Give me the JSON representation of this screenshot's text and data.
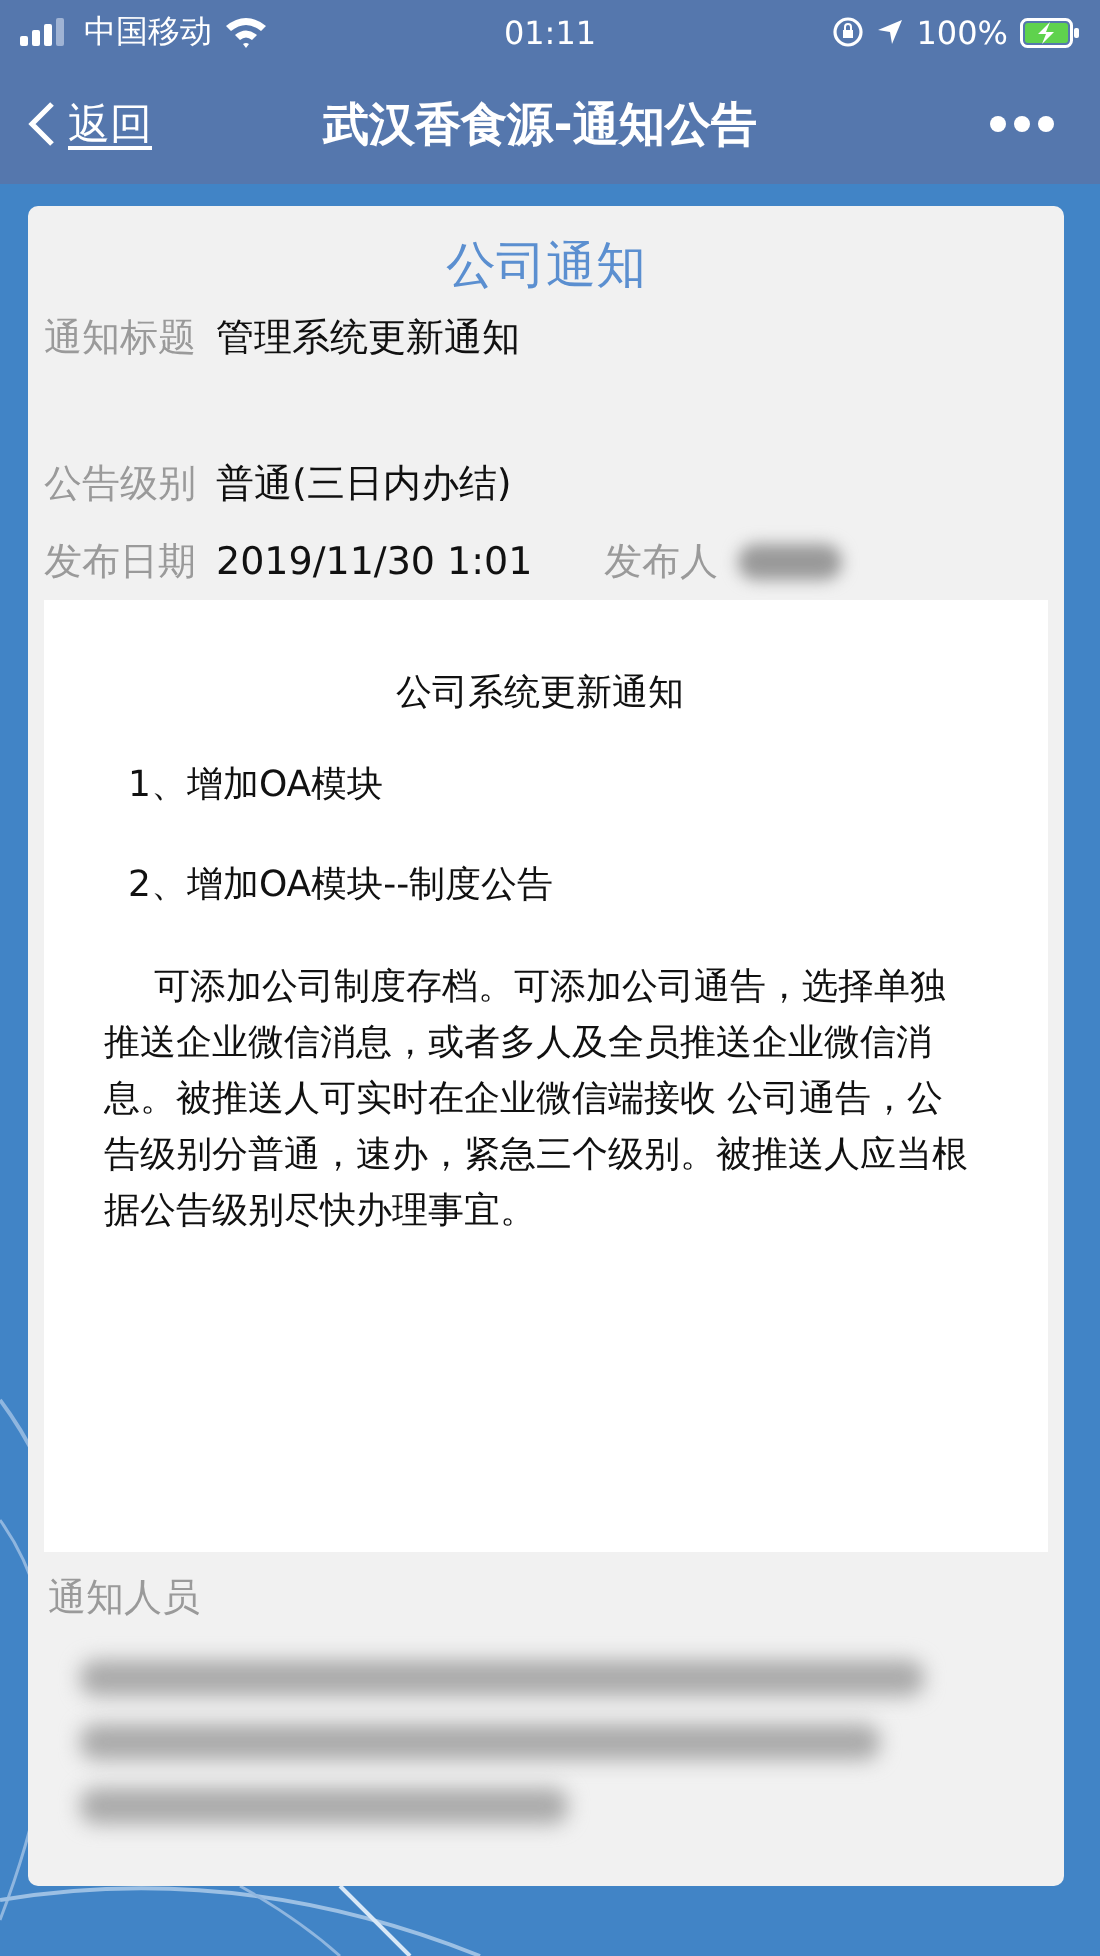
{
  "status_bar": {
    "carrier": "中国移动",
    "time": "01:11",
    "battery": "100%"
  },
  "nav_bar": {
    "back": "返回",
    "title": "武汉香食源-通知公告"
  },
  "card": {
    "heading": "公司通知",
    "fields": [
      {
        "label": "通知标题",
        "value": "管理系统更新通知"
      },
      {
        "label": "公告级别",
        "value": "普通(三日内办结)"
      }
    ],
    "date_row": {
      "label": "发布日期",
      "value": "2019/11/30 1:01",
      "publisher_label": "发布人"
    },
    "content": {
      "title": "公司系统更新通知",
      "items": [
        "1、增加OA模块",
        "2、增加OA模块--制度公告"
      ],
      "paragraph": "可添加公司制度存档。可添加公司通告，选择单独推送企业微信消息，或者多人及全员推送企业微信消息。被推送人可实时在企业微信端接收 公司通告，公告级别分普通，速办，紧急三个级别。被推送人应当根据公告级别尽快办理事宜。"
    },
    "recipients_label": "通知人员"
  }
}
